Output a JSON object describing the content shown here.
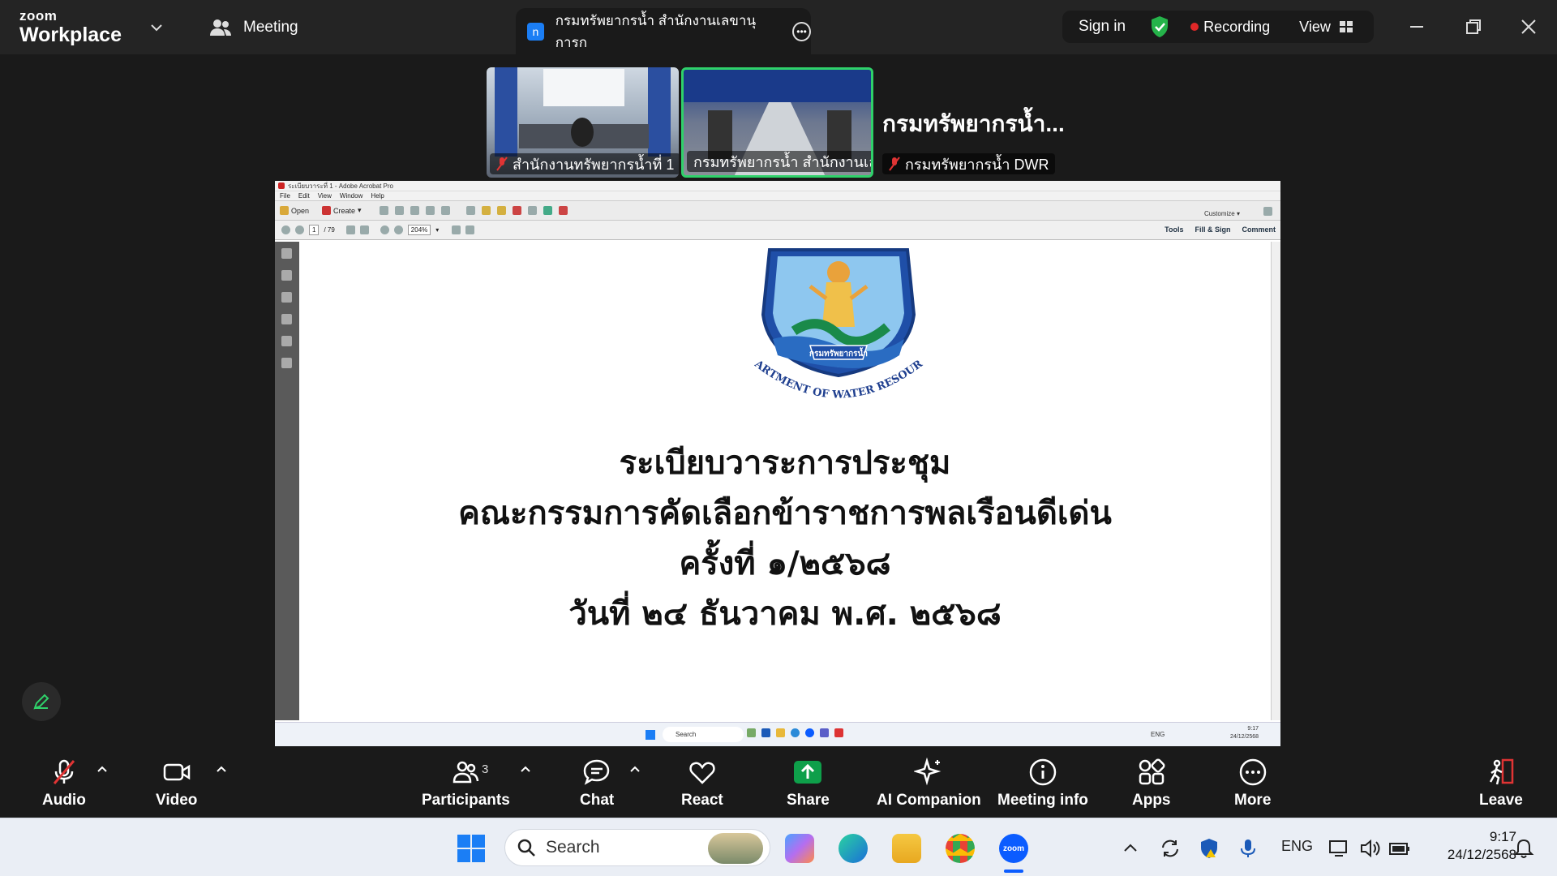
{
  "topbar": {
    "brand_line1": "zoom",
    "brand_line2": "Workplace",
    "meeting_label": "Meeting",
    "tab_icon_letter": "n",
    "tab_title": "กรมทรัพยากรน้ำ สำนักงานเลขานุการก",
    "sign_in": "Sign in",
    "recording": "Recording",
    "view": "View"
  },
  "participants_strip": [
    {
      "caption": "สำนักงานทรัพยากรน้ำที่ 1",
      "muted": true
    },
    {
      "caption": "กรมทรัพยากรน้ำ สำนักงานเล...",
      "muted": false,
      "active": true
    },
    {
      "caption": "กรมทรัพยากรน้ำ DWR",
      "name_large": "กรมทรัพยากรน้ำ...",
      "muted": true
    }
  ],
  "shared_screen": {
    "app_title": "ระเบียบวาระที่ 1 - Adobe Acrobat Pro",
    "menu": [
      "File",
      "Edit",
      "View",
      "Window",
      "Help"
    ],
    "toolbar": {
      "open": "Open",
      "create": "Create",
      "customize": "Customize"
    },
    "nav": {
      "page": "1",
      "total": "/ 79",
      "zoom": "204%"
    },
    "right_tabs": [
      "Tools",
      "Fill & Sign",
      "Comment"
    ],
    "logo_caption_thai": "กรมทรัพยากรน้ำ",
    "logo_caption_en": "DEPARTMENT OF WATER RESOURCES",
    "doc_lines": [
      "ระเบียบวาระการประชุม",
      "คณะกรรมการคัดเลือกข้าราชการพลเรือนดีเด่น",
      "ครั้งที่ ๑/๒๕๖๘",
      "วันที่ ๒๔ ธันวาคม พ.ศ. ๒๕๖๘"
    ],
    "inner_taskbar": {
      "search": "Search",
      "lang": "ENG",
      "time": "9:17",
      "date": "24/12/2568"
    }
  },
  "toolbar": {
    "audio": "Audio",
    "video": "Video",
    "participants": "Participants",
    "participants_count": "3",
    "chat": "Chat",
    "react": "React",
    "share": "Share",
    "ai": "AI Companion",
    "info": "Meeting info",
    "apps": "Apps",
    "more": "More",
    "leave": "Leave"
  },
  "taskbar": {
    "search": "Search",
    "lang": "ENG",
    "time": "9:17",
    "date": "24/12/2568"
  },
  "colors": {
    "accent_green": "#2fd16a",
    "share_green": "#0e9f4a",
    "record_red": "#e02828",
    "zoom_blue": "#0b5cff"
  }
}
